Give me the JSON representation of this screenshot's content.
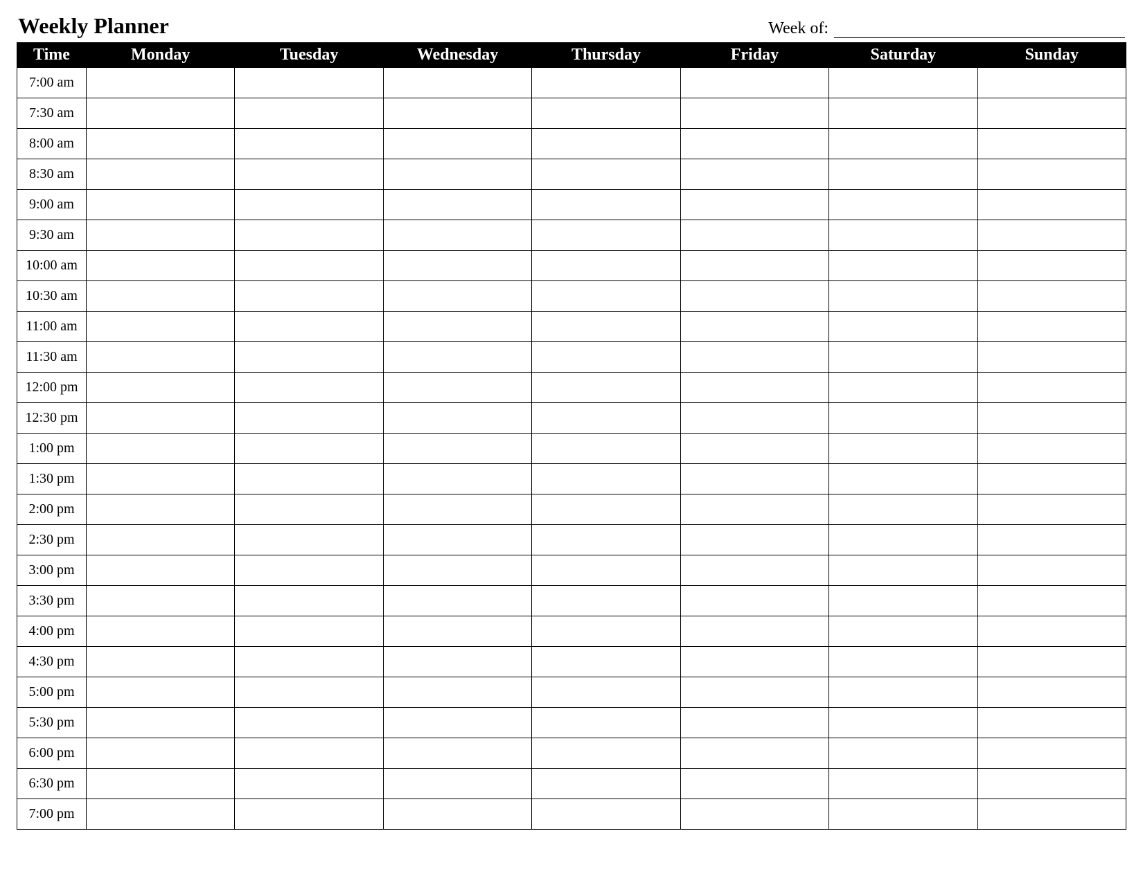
{
  "title": "Weekly Planner",
  "week_of_label": "Week of:",
  "week_of_value": "",
  "columns": [
    "Time",
    "Monday",
    "Tuesday",
    "Wednesday",
    "Thursday",
    "Friday",
    "Saturday",
    "Sunday"
  ],
  "times": [
    "7:00 am",
    "7:30 am",
    "8:00 am",
    "8:30 am",
    "9:00 am",
    "9:30 am",
    "10:00 am",
    "10:30 am",
    "11:00 am",
    "11:30 am",
    "12:00 pm",
    "12:30 pm",
    "1:00 pm",
    "1:30 pm",
    "2:00 pm",
    "2:30 pm",
    "3:00 pm",
    "3:30 pm",
    "4:00 pm",
    "4:30 pm",
    "5:00 pm",
    "5:30 pm",
    "6:00 pm",
    "6:30 pm",
    "7:00 pm"
  ]
}
